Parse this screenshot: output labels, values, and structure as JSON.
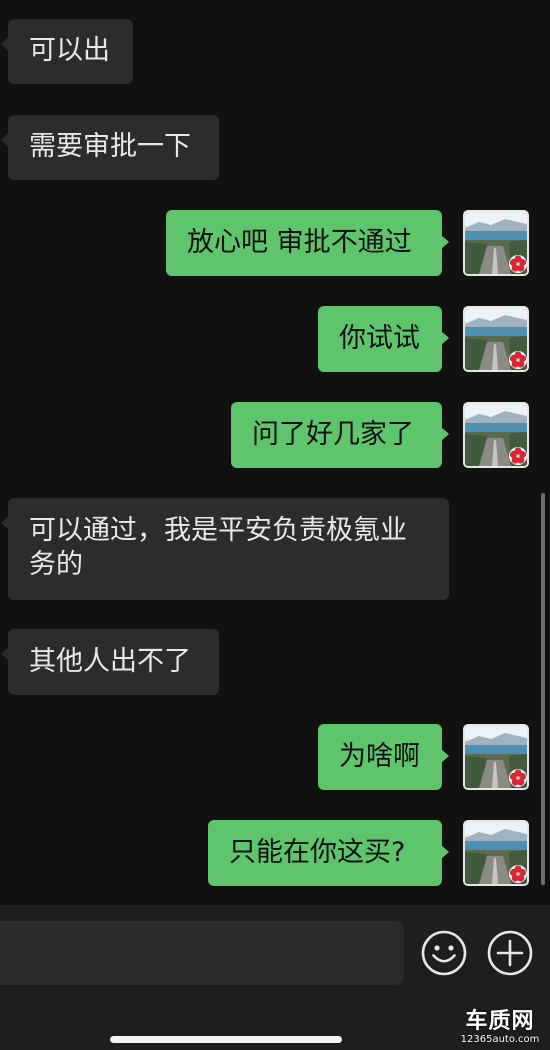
{
  "messages": [
    {
      "side": "in",
      "text": "可以出"
    },
    {
      "side": "in",
      "text": "需要审批一下"
    },
    {
      "side": "out",
      "text": "放心吧 审批不通过"
    },
    {
      "side": "out",
      "text": "你试试"
    },
    {
      "side": "out",
      "text": "问了好几家了"
    },
    {
      "side": "in",
      "text": "可以通过，我是平安负责极氪业\n务的"
    },
    {
      "side": "in",
      "text": "其他人出不了"
    },
    {
      "side": "out",
      "text": "为啥啊"
    },
    {
      "side": "out",
      "text": "只能在你这买?"
    }
  ],
  "input_bar": {
    "emoji_icon": "smiley-face-icon",
    "plus_icon": "plus-circle-icon"
  },
  "avatar": {
    "description_icon": "avatar-landscape-icon"
  },
  "colors": {
    "background": "#111111",
    "incoming_bubble": "#2c2c2c",
    "outgoing_bubble": "#5fc56d",
    "input_bar": "#1e1e1e"
  },
  "watermark": {
    "logo": "车质网",
    "url": "12365auto.com"
  }
}
